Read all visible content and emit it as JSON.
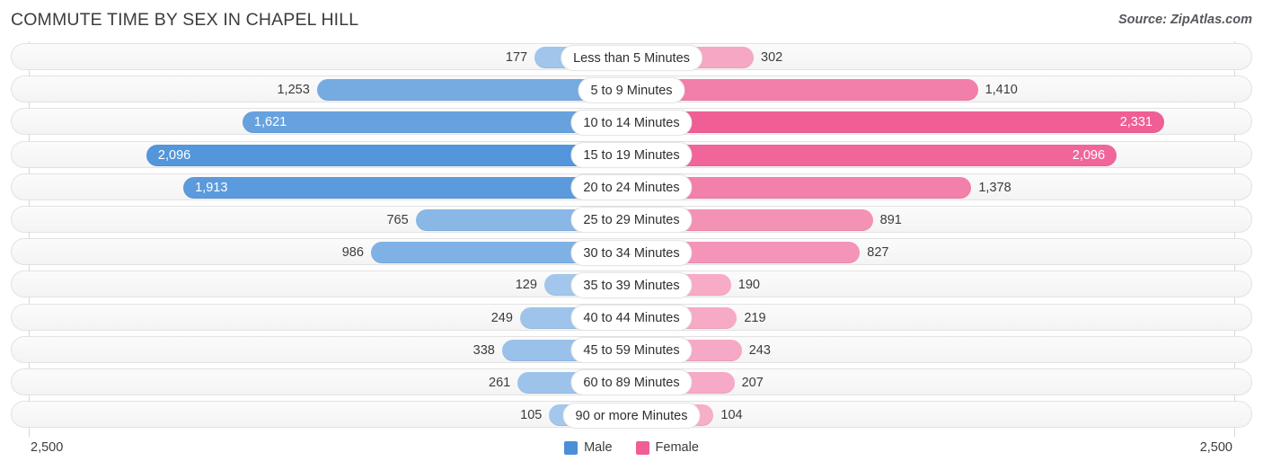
{
  "header": {
    "title": "COMMUTE TIME BY SEX IN CHAPEL HILL",
    "source": "Source: ZipAtlas.com"
  },
  "axis": {
    "left_label": "2,500",
    "right_label": "2,500"
  },
  "legend": {
    "items": [
      {
        "label": "Male",
        "color": "#4a90d9"
      },
      {
        "label": "Female",
        "color": "#ef5e94"
      }
    ]
  },
  "chart_data": {
    "type": "bar",
    "title": "COMMUTE TIME BY SEX IN CHAPEL HILL",
    "subtitle": "",
    "xlabel": "",
    "ylabel": "",
    "orientation": "horizontal-diverging",
    "axis_max": 2500,
    "xlim": [
      2500,
      2500
    ],
    "grid": false,
    "legend_position": "bottom-center",
    "categories": [
      "Less than 5 Minutes",
      "5 to 9 Minutes",
      "10 to 14 Minutes",
      "15 to 19 Minutes",
      "20 to 24 Minutes",
      "25 to 29 Minutes",
      "30 to 34 Minutes",
      "35 to 39 Minutes",
      "40 to 44 Minutes",
      "45 to 59 Minutes",
      "60 to 89 Minutes",
      "90 or more Minutes"
    ],
    "series": [
      {
        "name": "Male",
        "side": "left",
        "color": "#4a90d9",
        "values": [
          177,
          1253,
          1621,
          2096,
          1913,
          765,
          986,
          129,
          249,
          338,
          261,
          105
        ],
        "labels": [
          "177",
          "1,253",
          "1,621",
          "2,096",
          "1,913",
          "765",
          "986",
          "129",
          "249",
          "338",
          "261",
          "105"
        ]
      },
      {
        "name": "Female",
        "side": "right",
        "color": "#ef5e94",
        "values": [
          302,
          1410,
          2331,
          2096,
          1378,
          891,
          827,
          190,
          219,
          243,
          207,
          104
        ],
        "labels": [
          "302",
          "1,410",
          "2,331",
          "2,096",
          "1,378",
          "891",
          "827",
          "190",
          "219",
          "243",
          "207",
          "104"
        ]
      }
    ]
  }
}
